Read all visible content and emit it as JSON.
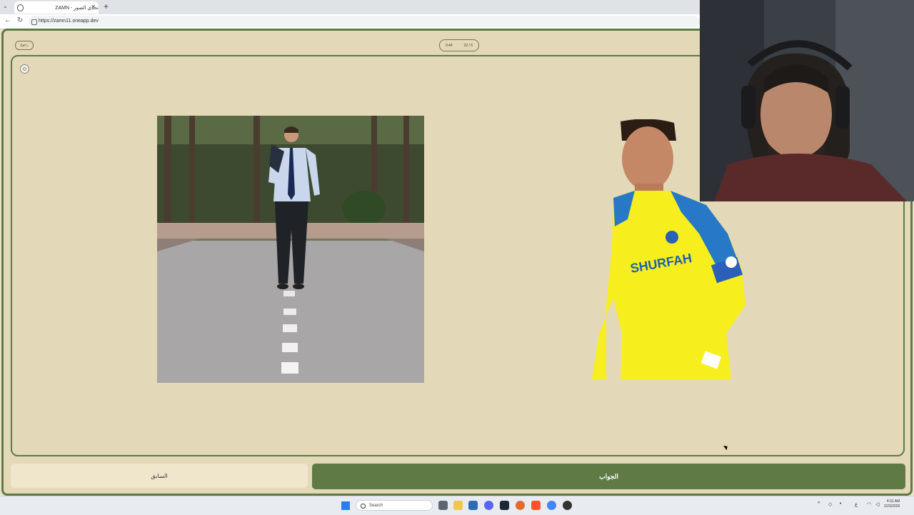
{
  "browser": {
    "tab_title": "ZAMN - تحدي الصور",
    "url": "https://zamn11.oneapp.dev",
    "new_tab_icon": "plus-icon",
    "close_icon": "close-icon"
  },
  "app": {
    "back_label": "رجوع",
    "timer": "0:44",
    "progress": "32 / 6",
    "previous_button": "السابق",
    "answer_button": "الجواب"
  },
  "taskbar": {
    "search_placeholder": "Search",
    "time": "4:31 AM",
    "date": "2/20/2026",
    "lang": "ع"
  },
  "colors": {
    "accent_green": "#5e7a45",
    "background": "#e3d9b8"
  }
}
